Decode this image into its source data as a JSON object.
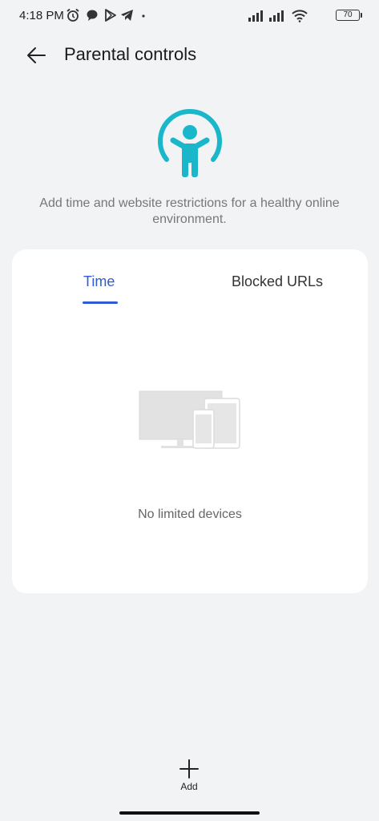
{
  "status_bar": {
    "time": "4:18 PM",
    "battery": "70",
    "left_icons": [
      "alarm-icon",
      "chat-bubble-icon",
      "play-store-icon",
      "telegram-icon",
      "dot-icon"
    ],
    "right_icons": [
      "signal-icon",
      "signal-icon",
      "wifi-icon",
      "battery-icon"
    ]
  },
  "header": {
    "title": "Parental controls",
    "back_icon": "arrow-left-icon"
  },
  "hero": {
    "icon": "child-icon",
    "description": "Add time and website restrictions for a healthy online environment.",
    "accent_color": "#19b7c9"
  },
  "tabs": [
    {
      "label": "Time",
      "active": true
    },
    {
      "label": "Blocked URLs",
      "active": false
    }
  ],
  "empty_state": {
    "illustration": "devices-icon",
    "text": "No limited devices"
  },
  "footer": {
    "add_label": "Add",
    "add_icon": "plus-icon"
  },
  "colors": {
    "background": "#f1f3f5",
    "card": "#ffffff",
    "tab_active": "#2f5bd6"
  }
}
